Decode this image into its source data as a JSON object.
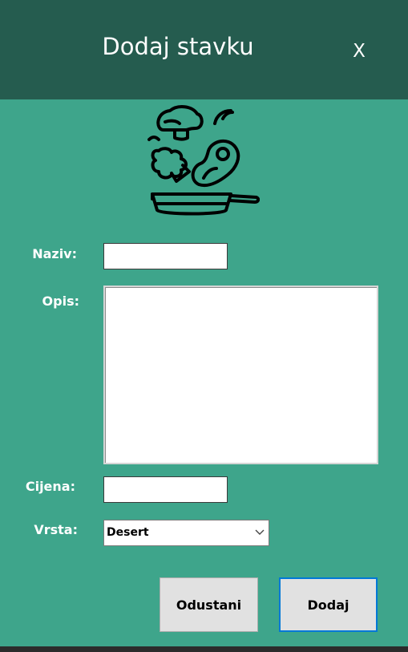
{
  "dialog": {
    "title": "Dodaj stavku",
    "close_label": "X"
  },
  "form": {
    "naziv": {
      "label": "Naziv:",
      "value": ""
    },
    "opis": {
      "label": "Opis:",
      "value": ""
    },
    "cijena": {
      "label": "Cijena:",
      "value": ""
    },
    "vrsta": {
      "label": "Vrsta:",
      "selected": "Desert"
    }
  },
  "buttons": {
    "cancel_label": "Odustani",
    "submit_label": "Dodaj"
  },
  "icons": {
    "header_illustration": "cooking-pan-icon",
    "dropdown": "chevron-down-icon"
  },
  "colors": {
    "header_bg": "#255c4f",
    "body_bg": "#3ea58b",
    "primary_border": "#0078d7"
  }
}
